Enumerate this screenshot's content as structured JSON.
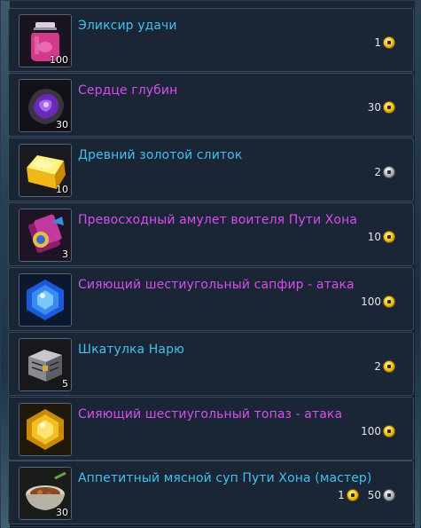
{
  "currency_colors": {
    "gold": "#f2c624",
    "silver": "#b8bcc2"
  },
  "items": [
    {
      "name": "Эликсир удачи",
      "color": "cyan",
      "count": "100",
      "icon": "potion-jar-icon",
      "price": [
        {
          "amount": "1",
          "coin": "gold"
        }
      ]
    },
    {
      "name": "Сердце глубин",
      "color": "purple",
      "count": "30",
      "icon": "purple-gem-heart-icon",
      "price": [
        {
          "amount": "30",
          "coin": "gold"
        }
      ]
    },
    {
      "name": "Древний золотой слиток",
      "color": "cyan",
      "count": "10",
      "icon": "gold-ingot-icon",
      "price": [
        {
          "amount": "2",
          "coin": "silver"
        }
      ]
    },
    {
      "name": "Превосходный амулет воителя Пути Хона",
      "color": "purple",
      "count": "3",
      "icon": "amulet-icon",
      "price": [
        {
          "amount": "10",
          "coin": "gold"
        }
      ]
    },
    {
      "name": "Сияющий шестиугольный сапфир - атака",
      "color": "purple",
      "count": "",
      "icon": "sapphire-icon",
      "price": [
        {
          "amount": "100",
          "coin": "gold"
        }
      ]
    },
    {
      "name": "Шкатулка Нарю",
      "color": "cyan",
      "count": "5",
      "icon": "chest-box-icon",
      "price": [
        {
          "amount": "2",
          "coin": "gold"
        }
      ]
    },
    {
      "name": "Сияющий шестиугольный топаз - атака",
      "color": "purple",
      "count": "",
      "icon": "topaz-icon",
      "price": [
        {
          "amount": "100",
          "coin": "gold"
        }
      ]
    },
    {
      "name": "Аппетитный мясной суп Пути Хона (мастер)",
      "color": "cyan",
      "count": "30",
      "icon": "soup-bowl-icon",
      "price": [
        {
          "amount": "1",
          "coin": "gold"
        },
        {
          "amount": "50",
          "coin": "silver"
        }
      ]
    }
  ]
}
